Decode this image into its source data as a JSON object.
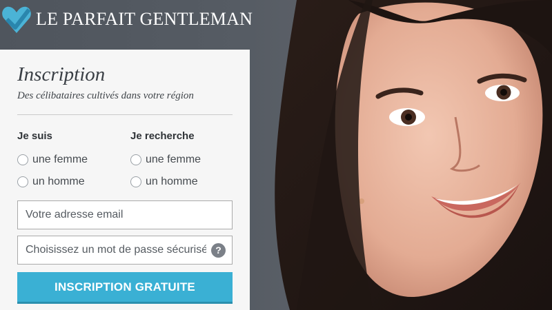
{
  "brand": {
    "name": "LE PARFAIT GENTLEMAN",
    "logo_icon": "heart-check-icon",
    "logo_colors": [
      "#4bb3d6",
      "#2a86ad"
    ]
  },
  "form": {
    "title": "Inscription",
    "subtitle": "Des célibataires cultivés dans votre région",
    "i_am": {
      "label": "Je suis",
      "options": [
        "une femme",
        "un homme"
      ]
    },
    "looking_for": {
      "label": "Je recherche",
      "options": [
        "une femme",
        "un homme"
      ]
    },
    "email": {
      "placeholder": "Votre adresse email",
      "value": ""
    },
    "password": {
      "placeholder": "Choisissez un mot de passe sécurisé",
      "value": "",
      "help_label": "?"
    },
    "submit_label": "INSCRIPTION GRATUITE"
  },
  "colors": {
    "accent": "#3ab0d4",
    "panel": "#f6f6f6",
    "background": "#565c64"
  }
}
